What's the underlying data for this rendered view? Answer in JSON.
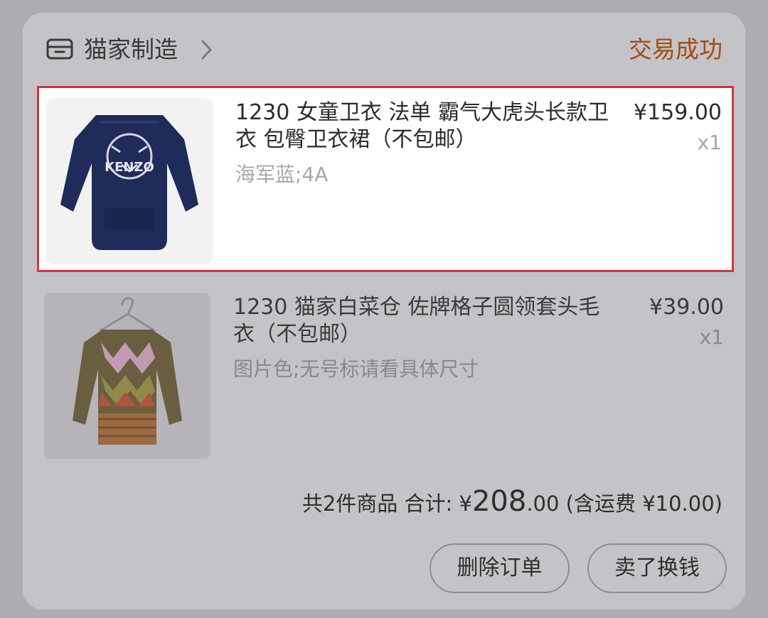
{
  "shop": {
    "name": "猫家制造",
    "icon": "shop-icon",
    "chevron_icon": "chevron-right-icon"
  },
  "order": {
    "status": "交易成功",
    "status_color": "#a24c12"
  },
  "items": [
    {
      "title": "1230 女童卫衣 法单 霸气大虎头长款卫衣 包臀卫衣裙（不包邮）",
      "sku": "海军蓝;4A",
      "price": "¥159.00",
      "quantity": "x1",
      "image_icon": "tiger-sweatshirt-image",
      "image_text": "KENZO",
      "highlighted": true,
      "highlight_color": "#c8393c"
    },
    {
      "title": "1230 猫家白菜仓  佐牌格子圆领套头毛衣（不包邮）",
      "sku": "图片色;无号标请看具体尺寸",
      "price": "¥39.00",
      "quantity": "x1",
      "image_icon": "argyle-sweater-image",
      "highlighted": false
    }
  ],
  "summary": {
    "count_text": "共2件商品",
    "total_label": "合计:",
    "currency": "¥",
    "total_integer": "208",
    "total_decimal": ".00",
    "shipping_text": "(含运费 ¥10.00)"
  },
  "actions": {
    "delete_label": "删除订单",
    "sell_label": "卖了换钱"
  }
}
